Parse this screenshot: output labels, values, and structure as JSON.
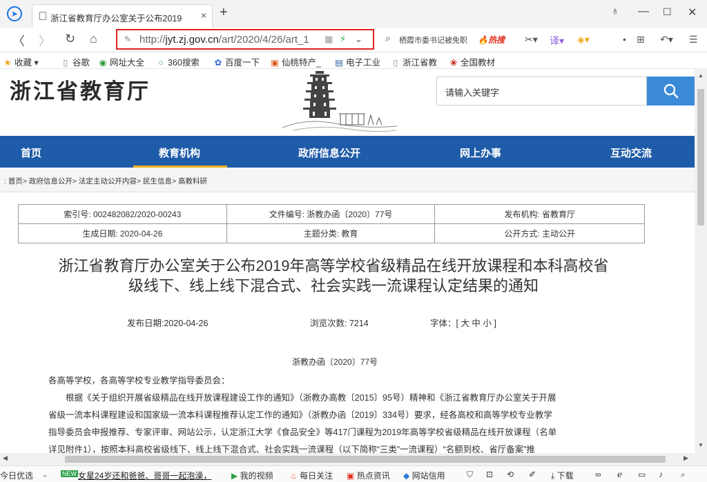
{
  "browser": {
    "tab_title": "浙江省教育厅办公室关于公布2019",
    "address": {
      "prefix": "http://",
      "host": "jyt.zj.gov.cn",
      "path": "/art/2020/4/26/art_1"
    },
    "search_hint": "栖霞市委书记被免职",
    "hot_label": "热搜"
  },
  "bookmarks": [
    {
      "label": "收藏",
      "icon": "star-icon"
    },
    {
      "label": "谷歌",
      "icon": "page-icon"
    },
    {
      "label": "网址大全",
      "icon": "globe-icon"
    },
    {
      "label": "360搜索",
      "icon": "search-icon"
    },
    {
      "label": "百度一下",
      "icon": "paw-icon"
    },
    {
      "label": "仙桃特产_",
      "icon": "badge-icon"
    },
    {
      "label": "电子工业",
      "icon": "book-icon"
    },
    {
      "label": "浙江省教",
      "icon": "page-icon"
    },
    {
      "label": "全国教材",
      "icon": "emblem-icon"
    }
  ],
  "site": {
    "title": "浙江省教育厅",
    "search_placeholder": "请输入关键字",
    "nav": [
      "首页",
      "教育机构",
      "政府信息公开",
      "网上办事",
      "互动交流"
    ],
    "breadcrumb": ": 首页> 政府信息公开> 法定主动公开内容> 民生信息> 高教科研"
  },
  "meta": {
    "index_no": "索引号: 002482082/2020-00243",
    "file_no": "文件编号: 浙教办函〔2020〕77号",
    "publisher": "发布机构: 省教育厅",
    "created": "生成日期: 2020-04-26",
    "category": "主题分类: 教育",
    "disclosure": "公开方式: 主动公开"
  },
  "article": {
    "title_line1": "浙江省教育厅办公室关于公布2019年高等学校省级精品在线开放课程和本科高校省",
    "title_line2": "级线下、线上线下混合式、社会实践一流课程认定结果的通知",
    "pub_date": "发布日期:2020-04-26",
    "views": "浏览次数: 7214",
    "font_size": "字体：[ 大 中 小 ]",
    "doc_number": "浙教办函〔2020〕77号",
    "salutation": "各高等学校，各高等学校专业教学指导委员会：",
    "lines": [
      "　　根据《关于组织开展省级精品在线开放课程建设工作的通知》（浙教办高教〔2015〕95号）精神和《浙江省教育厅办公室关于开展",
      "省级一流本科课程建设和国家级一流本科课程推荐认定工作的通知》（浙教办函〔2019〕334号）要求，经各高校和高等学校专业教学",
      "指导委员会申报推荐、专家评审、网站公示，认定浙江大学《食品安全》等417门课程为2019年高等学校省级精品在线开放课程（名单",
      "详见附件1），按照本科高校省级线下、线上线下混合式、社会实践一流课程（以下简称“三类”一流课程）“名额到校、省厅备案”推"
    ]
  },
  "statusbar": {
    "today": "今日优选",
    "news": "女星24岁还和爸爸、哥哥一起泡澡，",
    "video": "我的视频",
    "follow": "每日关注",
    "hot_news": "热点资讯",
    "trust": "网站信用",
    "download": "下载"
  }
}
